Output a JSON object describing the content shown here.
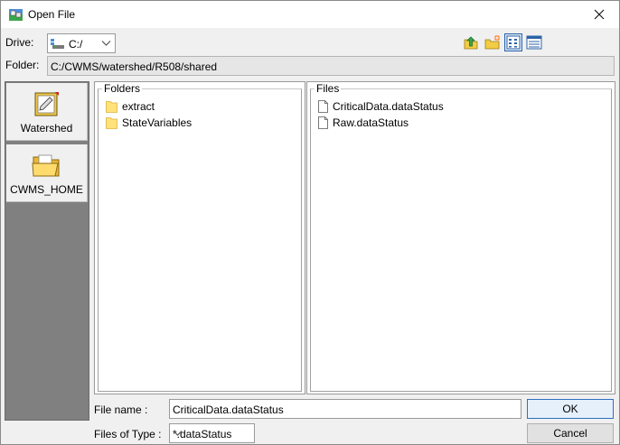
{
  "window": {
    "title": "Open File"
  },
  "drive": {
    "label": "Drive:",
    "value": "C:/"
  },
  "folder": {
    "label": "Folder:",
    "path": "C:/CWMS/watershed/R508/shared"
  },
  "toolbar": {
    "buttons": [
      "up-folder-icon",
      "new-folder-icon",
      "list-view-icon",
      "details-view-icon"
    ]
  },
  "sidebar": {
    "items": [
      {
        "label": "Watershed",
        "icon": "watershed-icon"
      },
      {
        "label": "CWMS_HOME",
        "icon": "open-folder-icon"
      }
    ]
  },
  "folders": {
    "legend": "Folders",
    "items": [
      "extract",
      "StateVariables"
    ]
  },
  "files": {
    "legend": "Files",
    "items": [
      "CriticalData.dataStatus",
      "Raw.dataStatus"
    ]
  },
  "filename": {
    "label": "File name :",
    "value": "CriticalData.dataStatus"
  },
  "filetype": {
    "label": "Files of Type :",
    "value": "*.dataStatus"
  },
  "actions": {
    "ok_label": "OK",
    "cancel_label": "Cancel"
  },
  "colors": {
    "accent": "#2f6fc0",
    "sidebar_bg": "#808080",
    "folder_yellow": "#ffe27a"
  }
}
